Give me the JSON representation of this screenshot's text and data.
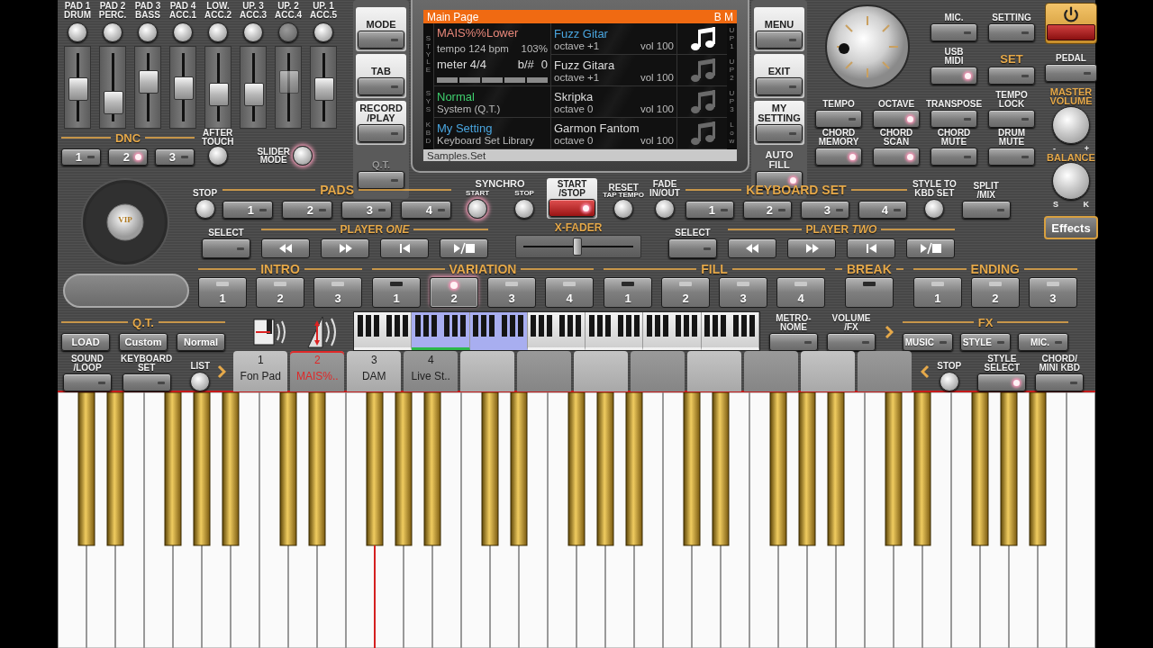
{
  "mixer": {
    "channels": [
      {
        "label": "PAD 1\nDRUM",
        "level": 0.44,
        "enabled": true
      },
      {
        "label": "PAD 2\nPERC.",
        "level": 0.2,
        "enabled": true
      },
      {
        "label": "PAD 3\nBASS",
        "level": 0.56,
        "enabled": true
      },
      {
        "label": "PAD 4\nACC.1",
        "level": 0.46,
        "enabled": true
      },
      {
        "label": "LOW.\nACC.2",
        "level": 0.35,
        "enabled": true
      },
      {
        "label": "UP. 3\nACC.3",
        "level": 0.35,
        "enabled": true
      },
      {
        "label": "UP. 2\nACC.4",
        "level": 0.56,
        "enabled": false
      },
      {
        "label": "UP. 1\nACC.5",
        "level": 0.44,
        "enabled": true
      }
    ],
    "dnc": {
      "title": "DNC",
      "buttons": [
        {
          "text": "1",
          "lit": false
        },
        {
          "text": "2",
          "lit": true
        },
        {
          "text": "3",
          "lit": false
        }
      ]
    },
    "after_touch": {
      "label": "AFTER\nTOUCH",
      "lit": false
    },
    "slider_mode": {
      "label": "SLIDER\nMODE",
      "lit": true
    }
  },
  "left_column": [
    {
      "label": "MODE",
      "kind": "boxed",
      "lit": false
    },
    {
      "label": "TAB",
      "kind": "boxed",
      "lit": false
    },
    {
      "label": "RECORD\n/PLAY",
      "kind": "boxed",
      "lit": false
    },
    {
      "label": "Q.T.",
      "kind": "dim",
      "lit": false
    }
  ],
  "display": {
    "title": "Main Page",
    "badge": "B M",
    "style": {
      "tag": "STYLE",
      "name": "MAIS%%Lower",
      "color": "#e8877a",
      "tempo": "tempo 124 bpm",
      "speed": "103%",
      "meter": "meter 4/4",
      "key_label": "b/#",
      "key": "0"
    },
    "sections": [
      {
        "tag": "SYS",
        "name": "Normal",
        "color": "#3fcf6e",
        "detail": "System (Q.T.)"
      },
      {
        "tag": "KBD",
        "name": "My Setting",
        "color": "#4aa6e0",
        "detail": "Keyboard Set Library"
      }
    ],
    "voices": [
      {
        "tag": "UP1",
        "name": "Fuzz Gitar",
        "octave": "octave +1",
        "volume": "vol 100",
        "selected": true
      },
      {
        "tag": "UP2",
        "name": "Fuzz Gitara",
        "octave": "octave +1",
        "volume": "vol 100",
        "selected": false
      },
      {
        "tag": "UP3",
        "name": "Skripka",
        "octave": "octave  0",
        "volume": "vol 100",
        "selected": false
      },
      {
        "tag": "Low",
        "name": "Garmon Fantom",
        "octave": "octave  0",
        "volume": "vol 100",
        "selected": false
      }
    ],
    "footer": "Samples.Set"
  },
  "right_column": [
    {
      "label": "MENU",
      "kind": "boxed",
      "lit": false
    },
    {
      "label": "EXIT",
      "kind": "boxed",
      "lit": false
    },
    {
      "label": "MY\nSETTING",
      "kind": "boxed",
      "lit": false
    },
    {
      "label": "AUTO\nFILL",
      "kind": "plain",
      "lit": true
    }
  ],
  "right_panel": [
    {
      "label": "MIC.",
      "lit": false,
      "accent": false
    },
    {
      "label": "SETTING",
      "lit": false,
      "accent": false
    },
    {
      "label": "USB\nMIDI",
      "lit": true,
      "accent": false
    },
    {
      "label": "SET",
      "lit": false,
      "accent": true
    },
    {
      "label": "TEMPO",
      "lit": false,
      "accent": false
    },
    {
      "label": "OCTAVE",
      "lit": true,
      "accent": false
    },
    {
      "label": "TRANSPOSE",
      "lit": false,
      "accent": false
    },
    {
      "label": "TEMPO\nLOCK",
      "lit": false,
      "accent": false
    },
    {
      "label": "CHORD\nMEMORY",
      "lit": true,
      "accent": false
    },
    {
      "label": "CHORD\nSCAN",
      "lit": true,
      "accent": false
    },
    {
      "label": "CHORD\nMUTE",
      "lit": false,
      "accent": false
    },
    {
      "label": "DRUM\nMUTE",
      "lit": false,
      "accent": false
    }
  ],
  "right_strip": {
    "pedal": "PEDAL",
    "master_volume": "MASTER\nVOLUME",
    "volume_marks": [
      "-",
      "+"
    ],
    "balance": "BALANCE",
    "balance_marks": [
      "S",
      "K"
    ],
    "effects": "Effects"
  },
  "jog": {
    "badge": "VIP"
  },
  "pads": {
    "stop": "STOP",
    "title": "PADS",
    "buttons": [
      "1",
      "2",
      "3",
      "4"
    ]
  },
  "synchro": {
    "title": "SYNCHRO",
    "start": {
      "label": "START",
      "lit": true
    },
    "stop": {
      "label": "STOP",
      "lit": false
    }
  },
  "start_stop": {
    "label": "START\n/STOP",
    "lit": true
  },
  "reset": {
    "label": "RESET",
    "sub": "TAP TEMPO"
  },
  "fade": {
    "label": "FADE\nIN/OUT"
  },
  "keyboard_set": {
    "title": "KEYBOARD SET",
    "buttons": [
      "1",
      "2",
      "3",
      "4"
    ],
    "style_to": "STYLE TO\nKBD SET"
  },
  "split": {
    "label": "SPLIT\n/MIX"
  },
  "players": [
    {
      "select": "SELECT",
      "title": "PLAYER *ONE*"
    },
    {
      "select": "SELECT",
      "title": "PLAYER *TWO*"
    }
  ],
  "xfader": {
    "label": "X-FADER",
    "level": 0.5
  },
  "sections": [
    {
      "title": "INTRO",
      "buttons": [
        {
          "text": "1",
          "on": false,
          "lit": false
        },
        {
          "text": "2",
          "on": false,
          "lit": false
        },
        {
          "text": "3",
          "on": false,
          "lit": false
        }
      ]
    },
    {
      "title": "VARIATION",
      "buttons": [
        {
          "text": "1",
          "on": true,
          "lit": false
        },
        {
          "text": "2",
          "on": false,
          "lit": true
        },
        {
          "text": "3",
          "on": false,
          "lit": false
        },
        {
          "text": "4",
          "on": false,
          "lit": false
        }
      ]
    },
    {
      "title": "FILL",
      "buttons": [
        {
          "text": "1",
          "on": true,
          "lit": false
        },
        {
          "text": "2",
          "on": false,
          "lit": false
        },
        {
          "text": "3",
          "on": false,
          "lit": false
        },
        {
          "text": "4",
          "on": false,
          "lit": false
        }
      ]
    },
    {
      "title": "BREAK",
      "buttons": [
        {
          "on": true,
          "lit": false
        }
      ]
    },
    {
      "title": "ENDING",
      "buttons": [
        {
          "text": "1",
          "on": false,
          "lit": false
        },
        {
          "text": "2",
          "on": false,
          "lit": false
        },
        {
          "text": "3",
          "on": false,
          "lit": false
        }
      ]
    }
  ],
  "qt": {
    "title": "Q.T.",
    "buttons": [
      "LOAD",
      "Custom",
      "Normal"
    ]
  },
  "mini_keyboard": [
    {
      "selected": false,
      "marked": false
    },
    {
      "selected": true,
      "marked": true
    },
    {
      "selected": true,
      "marked": false
    },
    {
      "selected": false,
      "marked": false
    },
    {
      "selected": false,
      "marked": false
    },
    {
      "selected": false,
      "marked": false
    },
    {
      "selected": false,
      "marked": false
    }
  ],
  "metronome": "METRO-\nNOME",
  "volume_fx": "VOLUME\n/FX",
  "fx": {
    "title": "FX",
    "buttons": [
      "MUSIC",
      "STYLE",
      "MIC."
    ]
  },
  "bottom_left": [
    "SOUND\n/LOOP",
    "KEYBOARD\nSET"
  ],
  "list": "LIST",
  "tabs": [
    {
      "number": "1",
      "name": "Fon Pad",
      "selected": false
    },
    {
      "number": "2",
      "name": "MAIS%..",
      "selected": true
    },
    {
      "number": "3",
      "name": "DAM",
      "selected": false
    },
    {
      "number": "4",
      "name": "Live St..",
      "selected": false
    },
    {
      "selected": false
    },
    {
      "selected": false
    },
    {
      "selected": false
    },
    {
      "selected": false
    },
    {
      "selected": false
    },
    {
      "selected": false
    },
    {
      "selected": false
    },
    {
      "selected": false
    }
  ],
  "bottom_stop": "STOP",
  "bottom_right": [
    {
      "label": "STYLE\nSELECT",
      "lit": true
    },
    {
      "label": "CHORD/\nMINI KBD",
      "lit": false
    }
  ]
}
